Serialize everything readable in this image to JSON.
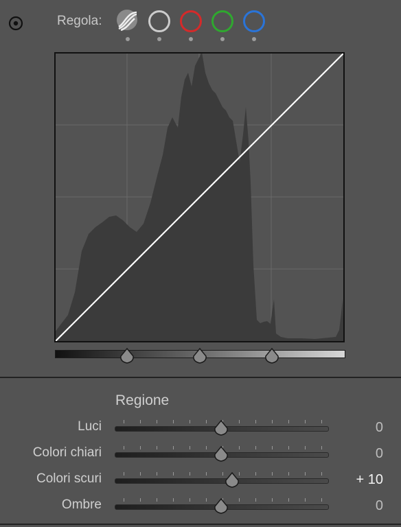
{
  "header": {
    "target_tool_icon": "target-adjustment-icon",
    "regola_label": "Regola:",
    "channels": [
      {
        "name": "parametric-curve",
        "icon": "parametric-curve-icon"
      },
      {
        "name": "rgb",
        "color": "#cccccc"
      },
      {
        "name": "red",
        "color": "#d42a2a"
      },
      {
        "name": "green",
        "color": "#2fa82f"
      },
      {
        "name": "blue",
        "color": "#2a74d8"
      }
    ]
  },
  "curve": {
    "type": "tone-curve",
    "line_color": "#ffffff",
    "points": [
      [
        0,
        0
      ],
      [
        100,
        100
      ]
    ],
    "histogram_color": "#3b3b3b",
    "split_points": [
      25,
      50,
      75
    ]
  },
  "regione": {
    "title": "Regione",
    "rows": [
      {
        "label": "Luci",
        "value": "0",
        "amount": 0
      },
      {
        "label": "Colori chiari",
        "value": "0",
        "amount": 0
      },
      {
        "label": "Colori scuri",
        "value": "+ 10",
        "amount": 10
      },
      {
        "label": "Ombre",
        "value": "0",
        "amount": 0
      }
    ],
    "range": [
      -100,
      100
    ]
  }
}
